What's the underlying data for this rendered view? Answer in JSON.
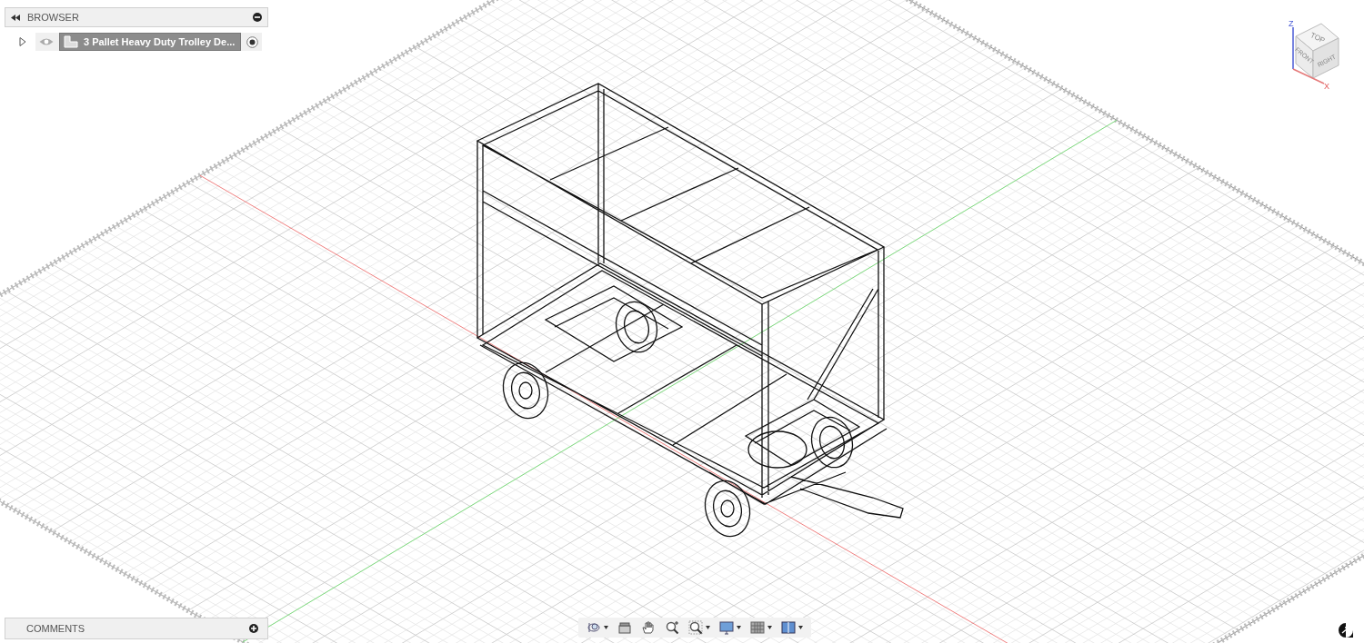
{
  "browser": {
    "title": "BROWSER",
    "items": [
      {
        "label": "3 Pallet Heavy Duty Trolley De...",
        "expanded": false,
        "visible": true,
        "active": true
      }
    ]
  },
  "viewcube": {
    "faces": [
      "TOP",
      "FRONT",
      "RIGHT"
    ],
    "axes": [
      "Z",
      "X"
    ]
  },
  "toolbar": {
    "tools": [
      {
        "kind": "orbit",
        "dropdown": true
      },
      {
        "kind": "look",
        "dropdown": false
      },
      {
        "kind": "pan",
        "dropdown": false
      },
      {
        "kind": "zoom",
        "dropdown": false
      },
      {
        "kind": "fit",
        "dropdown": true
      },
      {
        "kind": "display",
        "dropdown": true
      },
      {
        "kind": "grid",
        "dropdown": true
      },
      {
        "kind": "viewports",
        "dropdown": true
      }
    ]
  },
  "comments": {
    "title": "COMMENTS"
  }
}
